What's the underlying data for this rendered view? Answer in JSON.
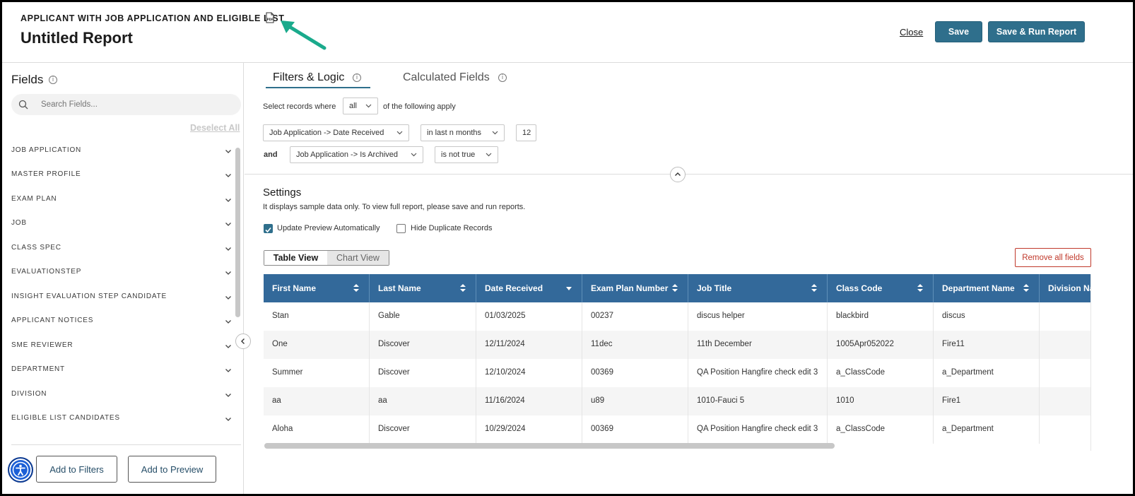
{
  "header": {
    "report_type": "APPLICANT WITH JOB APPLICATION AND ELIGIBLE LIST",
    "title": "Untitled Report",
    "close_label": "Close",
    "save_label": "Save",
    "save_run_label": "Save & Run Report"
  },
  "left_panel": {
    "title": "Fields",
    "search_placeholder": "Search Fields...",
    "deselect_all": "Deselect All",
    "groups": [
      "JOB APPLICATION",
      "MASTER PROFILE",
      "EXAM PLAN",
      "JOB",
      "CLASS SPEC",
      "EVALUATIONSTEP",
      "INSIGHT EVALUATION STEP CANDIDATE",
      "APPLICANT NOTICES",
      "SME REVIEWER",
      "DEPARTMENT",
      "DIVISION",
      "ELIGIBLE LIST CANDIDATES"
    ],
    "add_filters_label": "Add to Filters",
    "add_preview_label": "Add to Preview"
  },
  "tabs": {
    "filters": "Filters & Logic",
    "calculated": "Calculated Fields"
  },
  "logic": {
    "prefix": "Select records where",
    "mode": "all",
    "suffix": "of the following apply",
    "conditions": [
      {
        "connector": "",
        "field": "Job Application -> Date Received",
        "operator": "in last n months",
        "value": "12"
      },
      {
        "connector": "and",
        "field": "Job Application -> Is Archived",
        "operator": "is not true",
        "value": ""
      }
    ]
  },
  "settings": {
    "title": "Settings",
    "description": "It displays sample data only. To view full report, please save and run reports.",
    "update_preview_label": "Update Preview Automatically",
    "update_preview_checked": true,
    "hide_duplicates_label": "Hide Duplicate Records",
    "hide_duplicates_checked": false,
    "table_view_label": "Table View",
    "chart_view_label": "Chart View",
    "remove_all_label": "Remove all fields"
  },
  "table": {
    "columns": [
      "First Name",
      "Last Name",
      "Date Received",
      "Exam Plan Number",
      "Job Title",
      "Class Code",
      "Department Name",
      "Division Na"
    ],
    "rows": [
      [
        "Stan",
        "Gable",
        "01/03/2025",
        "00237",
        "discus helper",
        "blackbird",
        "discus",
        ""
      ],
      [
        "One",
        "Discover",
        "12/11/2024",
        "11dec",
        "11th December",
        "1005Apr052022",
        "Fire11",
        ""
      ],
      [
        "Summer",
        "Discover",
        "12/10/2024",
        "00369",
        "QA Position Hangfire check edit 3",
        "a_ClassCode",
        "a_Department",
        ""
      ],
      [
        "aa",
        "aa",
        "11/16/2024",
        "u89",
        "1010-Fauci 5",
        "1010",
        "Fire1",
        ""
      ],
      [
        "Aloha",
        "Discover",
        "10/29/2024",
        "00369",
        "QA Position Hangfire check edit 3",
        "a_ClassCode",
        "a_Department",
        ""
      ]
    ]
  },
  "colors": {
    "primary": "#2f6f8c",
    "table_header": "#33699a",
    "danger": "#c0392b",
    "annotation_arrow": "#1aaa8c"
  }
}
